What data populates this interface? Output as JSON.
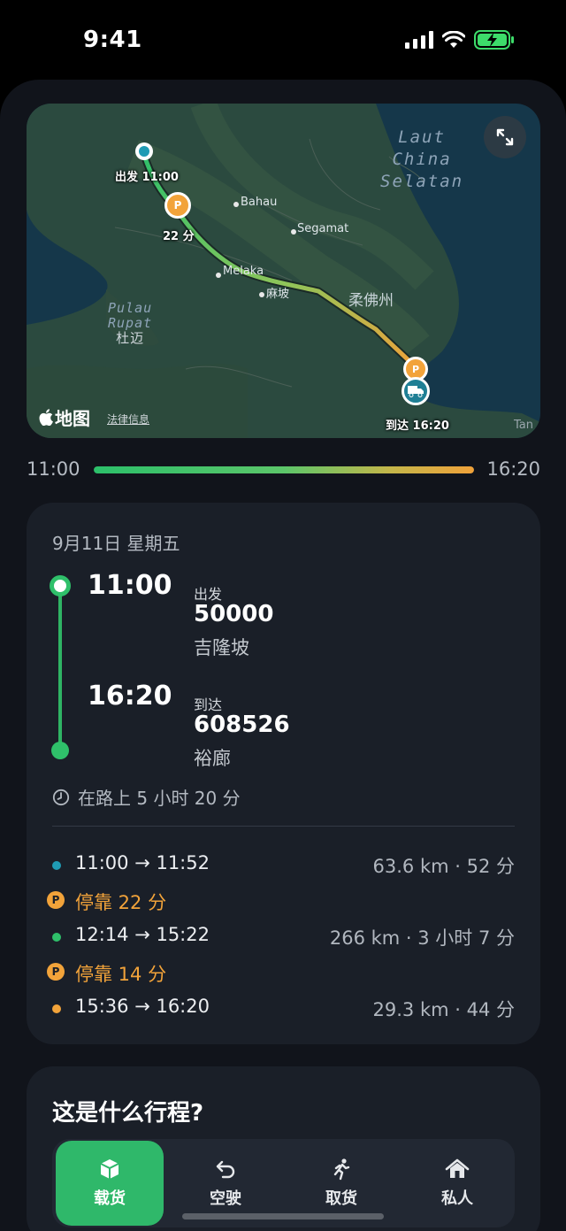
{
  "status_bar": {
    "time": "9:41"
  },
  "map": {
    "sea_labels": [
      "Laut",
      "China",
      "Selatan"
    ],
    "island_labels": [
      "Pulau",
      "Rupat",
      "杜迈"
    ],
    "towns": [
      "Bahau",
      "Segamat",
      "Melaka",
      "麻坡",
      "Tan"
    ],
    "region_label": "柔佛州",
    "start_label": "出发 11:00",
    "stop_label": "22 分",
    "end_label": "到达 16:20",
    "parking_glyph": "P",
    "brand": "地图",
    "legal": "法律信息"
  },
  "progress": {
    "start": "11:00",
    "end": "16:20",
    "fraction": 1.0
  },
  "trip": {
    "date": "9月11日 星期五",
    "departure": {
      "time": "11:00",
      "label": "出发",
      "code": "50000",
      "place": "吉隆坡"
    },
    "arrival": {
      "time": "16:20",
      "label": "到达",
      "code": "608526",
      "place": "裕廊"
    },
    "duration": "在路上 5 小时 20 分",
    "segments": [
      {
        "time": "11:00 → 11:52",
        "meta": "63.6 km · 52 分",
        "color": "#1f9bb4"
      },
      {
        "stop": "停靠 22 分"
      },
      {
        "time": "12:14 → 15:22",
        "meta": "266 km · 3 小时 7 分",
        "color": "#2fc06a"
      },
      {
        "stop": "停靠 14 分"
      },
      {
        "time": "15:36 → 16:20",
        "meta": "29.3 km · 44 分",
        "color": "#f2a33a"
      }
    ]
  },
  "trip_type": {
    "title": "这是什么行程?",
    "options": [
      {
        "label": "载货",
        "icon": "package-icon",
        "selected": true
      },
      {
        "label": "空驶",
        "icon": "return-arrow-icon",
        "selected": false
      },
      {
        "label": "取货",
        "icon": "running-person-icon",
        "selected": false
      },
      {
        "label": "私人",
        "icon": "house-icon",
        "selected": false
      }
    ]
  },
  "colors": {
    "accent": "#2fb86a",
    "stop": "#f2a33a",
    "start_dot": "#1f9bb4"
  }
}
